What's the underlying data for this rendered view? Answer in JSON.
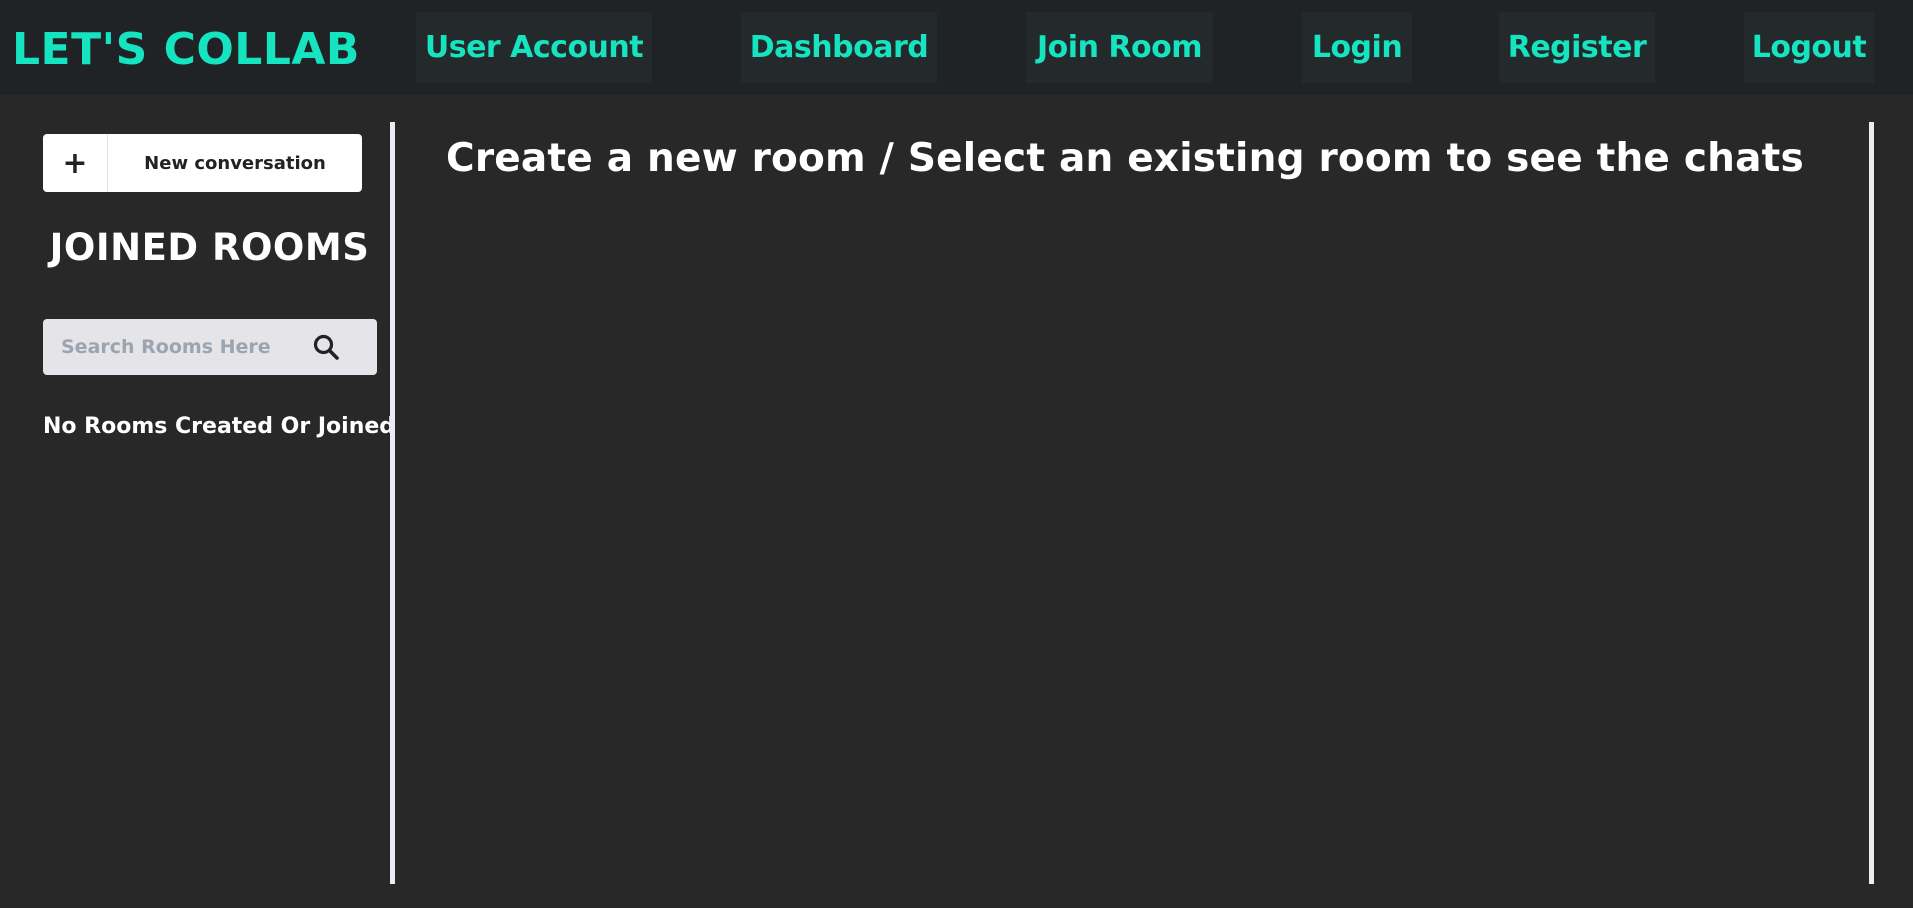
{
  "header": {
    "brand": "LET'S COLLAB",
    "nav": {
      "user_account": "User Account",
      "dashboard": "Dashboard",
      "join_room": "Join Room",
      "login": "Login",
      "register": "Register",
      "logout": "Logout"
    }
  },
  "sidebar": {
    "new_conversation": {
      "icon_symbol": "+",
      "icon": "plus-icon",
      "label": "New conversation"
    },
    "joined_rooms_title": "JOINED ROOMS",
    "search": {
      "placeholder": "Search Rooms Here",
      "value": "",
      "icon": "search-icon"
    },
    "empty_message": "No Rooms Created Or Joined"
  },
  "main": {
    "heading": "Create a new room / Select an existing room to see the chats"
  },
  "colors": {
    "accent": "#16e3bf",
    "header_bg": "#1f2326",
    "nav_item_bg": "#24292c",
    "page_bg": "#282828",
    "divider": "#ececf2",
    "search_bg": "#e4e4e9",
    "text_light": "#ffffff"
  }
}
